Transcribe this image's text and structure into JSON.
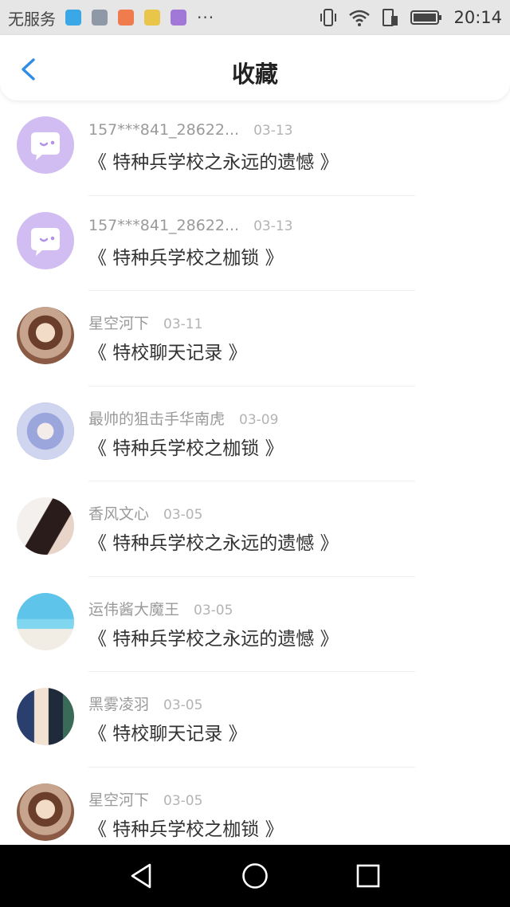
{
  "status_bar": {
    "carrier": "无服务",
    "more": "···",
    "time": "20:14",
    "notification_icons": [
      {
        "name": "app-icon-blue",
        "color": "#3aa7e6"
      },
      {
        "name": "gallery-icon",
        "color": "#8e98a6"
      },
      {
        "name": "video-icon",
        "color": "#f07b4d"
      },
      {
        "name": "smile-icon",
        "color": "#e9c64a"
      },
      {
        "name": "keyboard-icon",
        "color": "#a178d8"
      }
    ]
  },
  "header": {
    "title": "收藏",
    "back_icon": "chevron-left-icon",
    "accent": "#2f8de4"
  },
  "favorites": [
    {
      "user": "157***841_28622...",
      "date": "03-13",
      "book": "《 特种兵学校之永远的遗憾 》",
      "avatar": "chat-bubble-icon"
    },
    {
      "user": "157***841_28622...",
      "date": "03-13",
      "book": "《 特种兵学校之枷锁 》",
      "avatar": "chat-bubble-icon"
    },
    {
      "user": "星空河下",
      "date": "03-11",
      "book": "《 特校聊天记录 》",
      "avatar": "anime-girl-avatar"
    },
    {
      "user": "最帅的狙击手华南虎",
      "date": "03-09",
      "book": "《 特种兵学校之枷锁 》",
      "avatar": "anime-girl-blue-avatar"
    },
    {
      "user": "香风文心",
      "date": "03-05",
      "book": "《 特种兵学校之永远的遗憾 》",
      "avatar": "girl-portrait-avatar"
    },
    {
      "user": "运伟酱大魔王",
      "date": "03-05",
      "book": "《 特种兵学校之永远的遗憾 》",
      "avatar": "sea-avatar"
    },
    {
      "user": "黑雾凌羽",
      "date": "03-05",
      "book": "《 特校聊天记录 》",
      "avatar": "anime-boys-avatar"
    },
    {
      "user": "星空河下",
      "date": "03-05",
      "book": "《 特种兵学校之枷锁 》",
      "avatar": "anime-girl-avatar"
    }
  ],
  "nav_bar": {
    "back": "triangle-back-icon",
    "home": "circle-home-icon",
    "recent": "square-recent-icon"
  }
}
